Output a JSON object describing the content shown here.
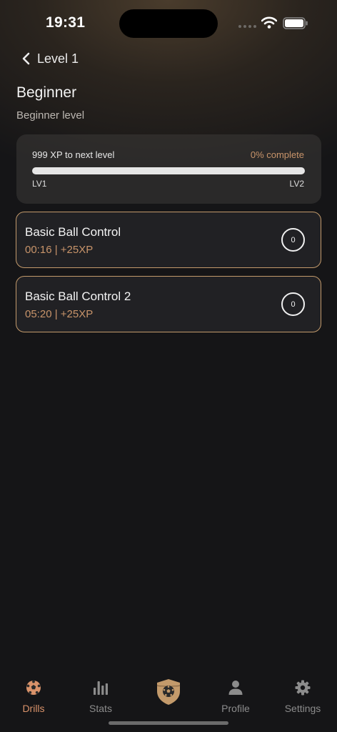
{
  "status_bar": {
    "time": "19:31"
  },
  "header": {
    "back_label": "Level 1"
  },
  "level": {
    "title": "Beginner",
    "subtitle": "Beginner level"
  },
  "progress": {
    "xp_to_next": "999 XP to next level",
    "percent_label": "0% complete",
    "percent_value": 0,
    "from_level": "LV1",
    "to_level": "LV2"
  },
  "drills": [
    {
      "title": "Basic Ball Control",
      "meta": "00:16 | +25XP",
      "count": "0"
    },
    {
      "title": "Basic Ball Control 2",
      "meta": "05:20 | +25XP",
      "count": "0"
    }
  ],
  "tabs": [
    {
      "label": "Drills",
      "icon": "soccer-ball-icon",
      "active": true
    },
    {
      "label": "Stats",
      "icon": "bar-chart-icon",
      "active": false
    },
    {
      "label": "",
      "icon": "shield-ball-icon",
      "active": false
    },
    {
      "label": "Profile",
      "icon": "person-icon",
      "active": false
    },
    {
      "label": "Settings",
      "icon": "gear-icon",
      "active": false
    }
  ],
  "colors": {
    "accent": "#c8946a",
    "active_tab": "#d9926a",
    "background": "#151517",
    "card_border": "#c39a6b"
  }
}
